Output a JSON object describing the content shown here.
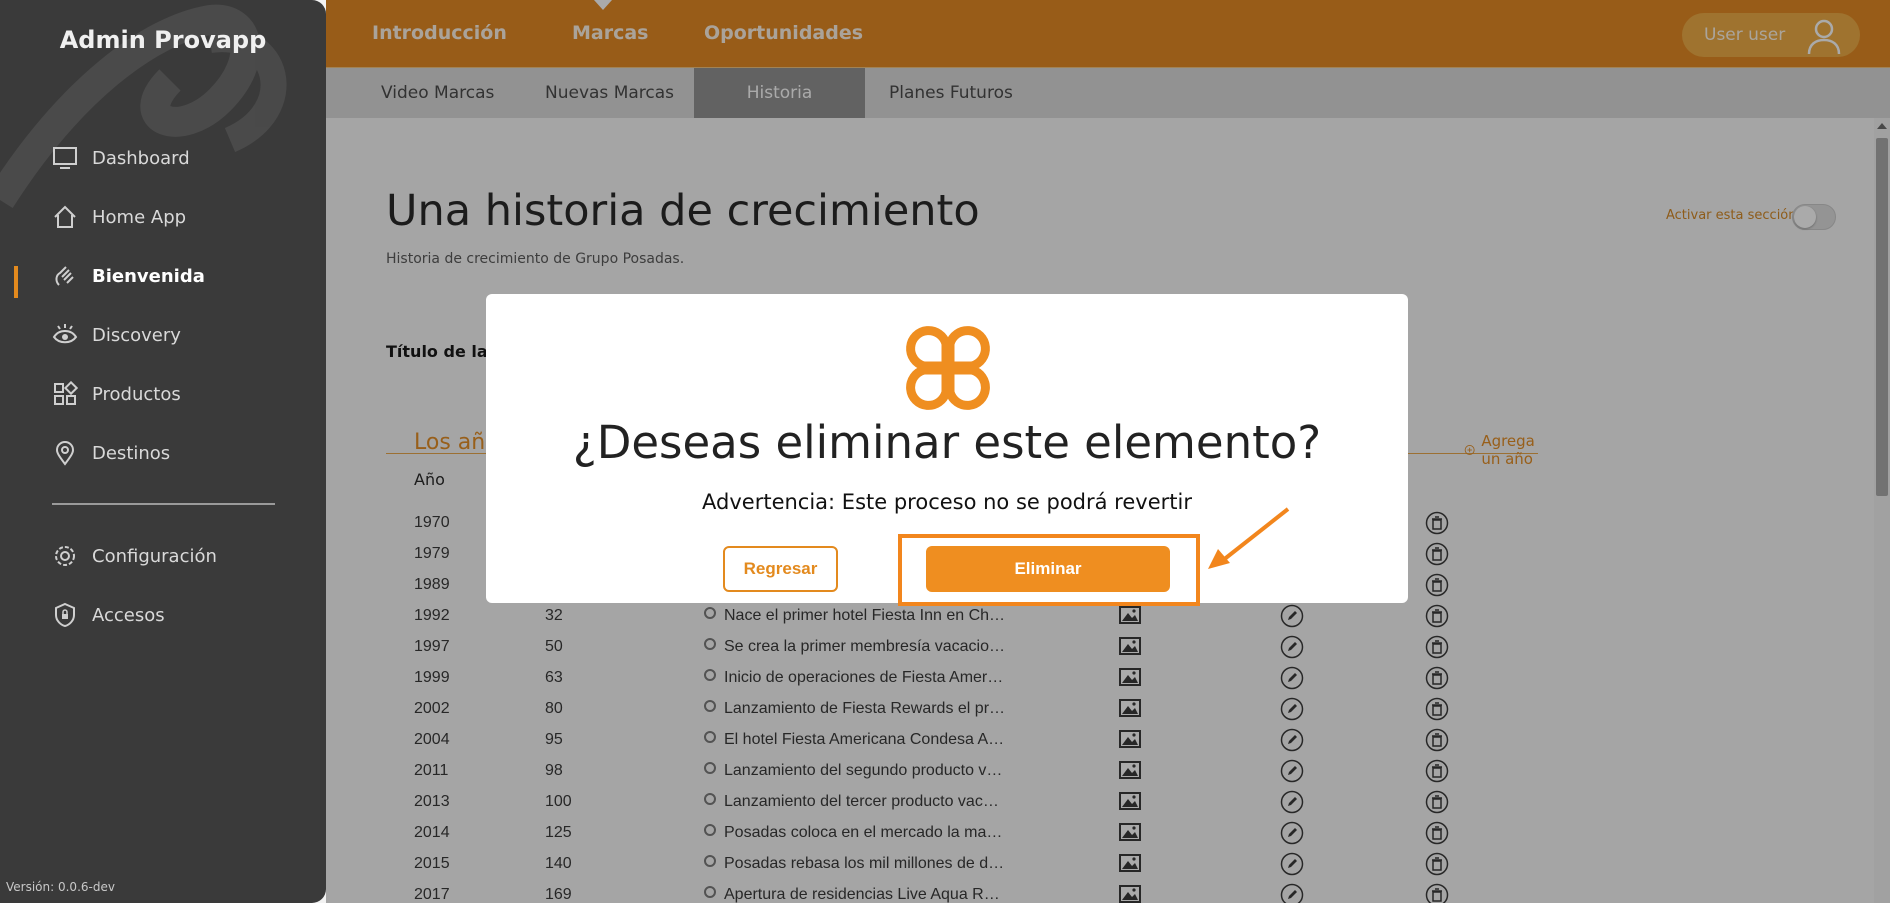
{
  "sidebar": {
    "brand": "Admin Provapp",
    "items": [
      {
        "label": "Dashboard",
        "icon": "monitor-icon"
      },
      {
        "label": "Home App",
        "icon": "home-icon"
      },
      {
        "label": "Bienvenida",
        "icon": "wave-hand-icon",
        "active": true
      },
      {
        "label": "Discovery",
        "icon": "eye-icon"
      },
      {
        "label": "Productos",
        "icon": "grid-icon"
      },
      {
        "label": "Destinos",
        "icon": "map-pin-icon"
      },
      {
        "label": "Configuración",
        "icon": "gear-icon"
      },
      {
        "label": "Accesos",
        "icon": "shield-lock-icon"
      }
    ],
    "version": "Versión: 0.0.6-dev"
  },
  "topbar": {
    "nav": [
      "Introducción",
      "Marcas",
      "Oportunidades"
    ],
    "active_nav": "Marcas",
    "user_label": "User user"
  },
  "subtabs": {
    "items": [
      "Video Marcas",
      "Nuevas Marcas",
      "Historia",
      "Planes Futuros"
    ],
    "active": "Historia"
  },
  "main": {
    "title": "Una historia de crecimiento",
    "subtitle": "Historia de crecimiento de Grupo Posadas.",
    "toggle_label": "Activar esta sección",
    "toggle_on": false,
    "field_label": "Título de la p",
    "section_title": "Los añ",
    "add_year": "Agrega un año",
    "column_year": "Año",
    "rows": [
      {
        "year": "1970",
        "num": "",
        "desc": ""
      },
      {
        "year": "1979",
        "num": "",
        "desc": ""
      },
      {
        "year": "1989",
        "num": "",
        "desc": ""
      },
      {
        "year": "1992",
        "num": "32",
        "desc": "Nace el primer hotel Fiesta Inn en Ch…"
      },
      {
        "year": "1997",
        "num": "50",
        "desc": "Se crea la primer membresía vacacio…"
      },
      {
        "year": "1999",
        "num": "63",
        "desc": "Inicio de operaciones de Fiesta Amer…"
      },
      {
        "year": "2002",
        "num": "80",
        "desc": "Lanzamiento de Fiesta Rewards el pr…"
      },
      {
        "year": "2004",
        "num": "95",
        "desc": "El hotel Fiesta Americana Condesa A…"
      },
      {
        "year": "2011",
        "num": "98",
        "desc": "Lanzamiento del segundo producto v…"
      },
      {
        "year": "2013",
        "num": "100",
        "desc": "Lanzamiento del tercer producto vac…"
      },
      {
        "year": "2014",
        "num": "125",
        "desc": "Posadas coloca en el mercado la ma…"
      },
      {
        "year": "2015",
        "num": "140",
        "desc": "Posadas rebasa los mil millones de d…"
      },
      {
        "year": "2017",
        "num": "169",
        "desc": "Apertura de residencias Live Aqua R…"
      }
    ]
  },
  "modal": {
    "title": "¿Deseas eliminar este elemento?",
    "warning": "Advertencia: Este proceso no se podrá revertir",
    "back_label": "Regresar",
    "delete_label": "Eliminar"
  },
  "colors": {
    "accent": "#e38a1e",
    "sidebar_bg": "#3a3a3a",
    "highlight": "#f2861d"
  }
}
